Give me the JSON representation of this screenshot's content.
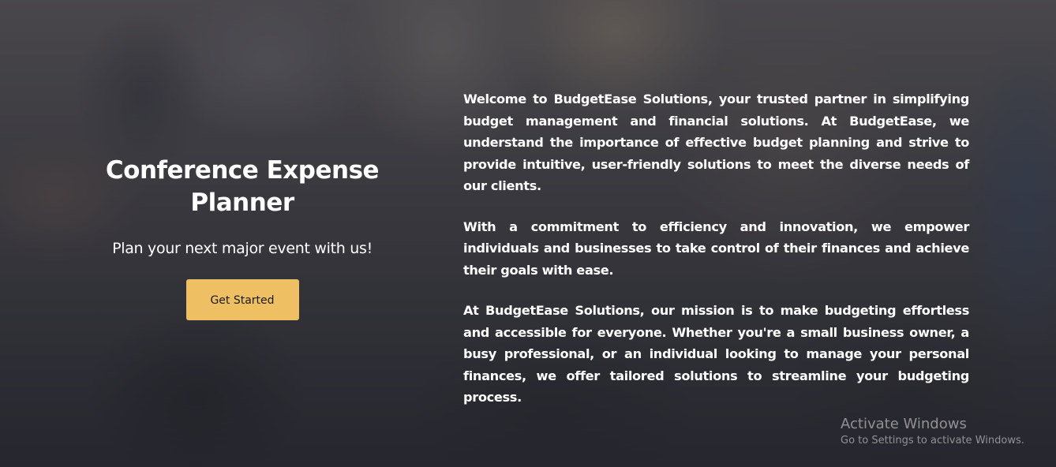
{
  "hero": {
    "title": "Conference Expense Planner",
    "subtitle": "Plan your next major event with us!",
    "cta_label": "Get Started",
    "cta_color": "#eec063"
  },
  "about": {
    "paragraphs": [
      "Welcome to BudgetEase Solutions, your trusted partner in simplifying budget management and financial solutions. At BudgetEase, we understand the importance of effective budget planning and strive to provide intuitive, user-friendly solutions to meet the diverse needs of our clients.",
      "With a commitment to efficiency and innovation, we empower individuals and businesses to take control of their finances and achieve their goals with ease.",
      "At BudgetEase Solutions, our mission is to make budgeting effortless and accessible for everyone. Whether you're a small business owner, a busy professional, or an individual looking to manage your personal finances, we offer tailored solutions to streamline your budgeting process."
    ]
  },
  "watermark": {
    "title": "Activate Windows",
    "subtitle": "Go to Settings to activate Windows."
  }
}
